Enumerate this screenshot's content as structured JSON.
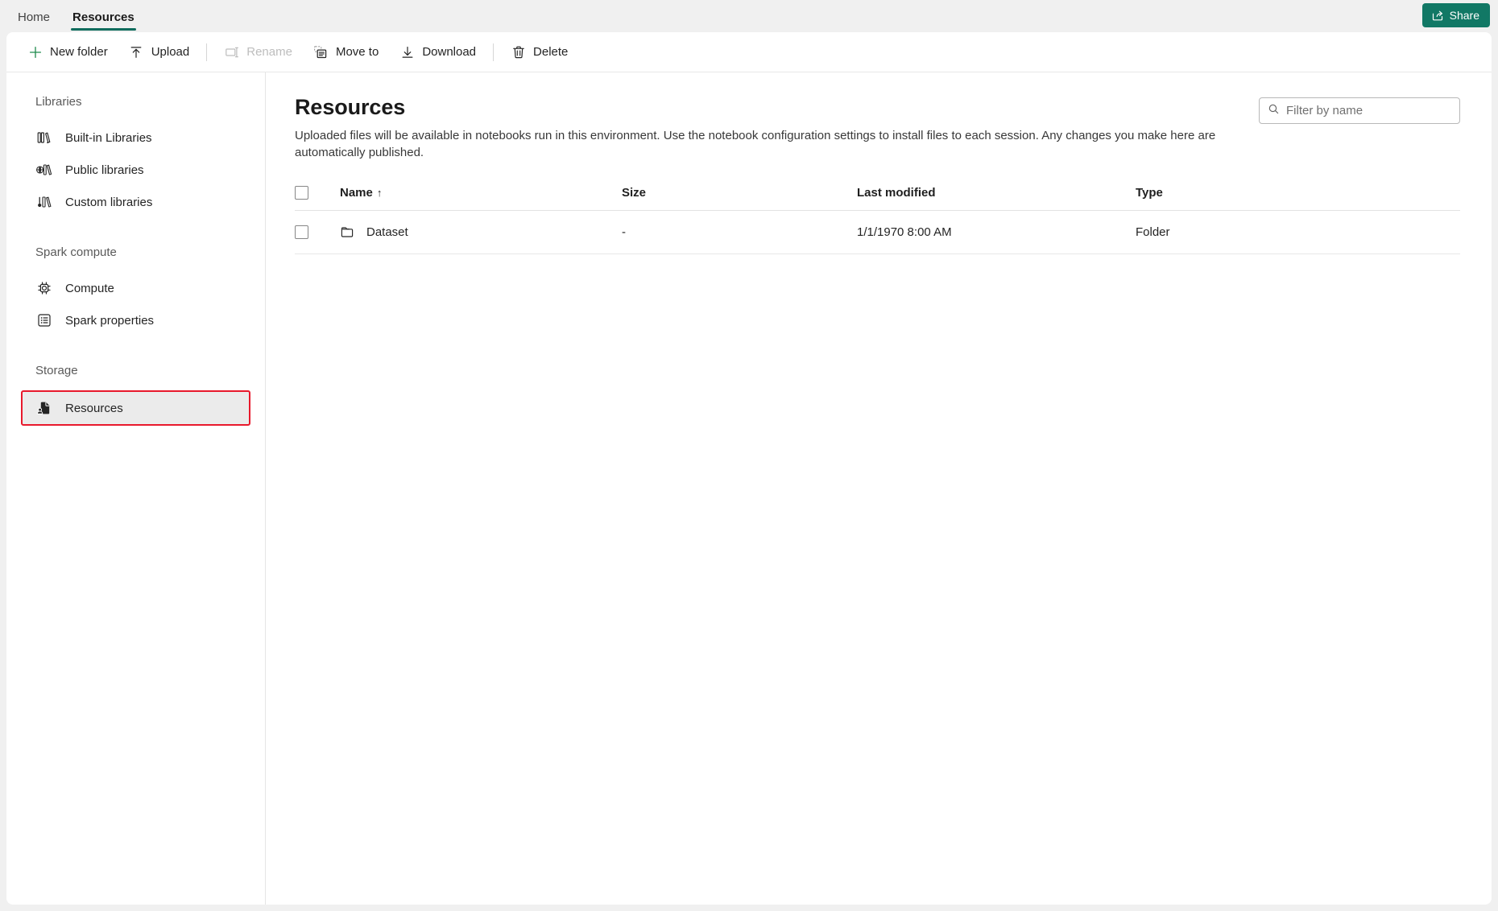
{
  "window": {
    "tabs": [
      {
        "label": "Home",
        "active": false
      },
      {
        "label": "Resources",
        "active": true
      }
    ],
    "share_label": "Share",
    "share_icon": "share-icon",
    "accent_color": "#117865",
    "tab_underline_color": "#0f6c5d",
    "highlight_color": "#e8192c"
  },
  "toolbar": {
    "items": [
      {
        "label": "New folder",
        "icon": "plus-icon",
        "disabled": false,
        "icon_color": "#1e8a4c"
      },
      {
        "label": "Upload",
        "icon": "upload-icon",
        "disabled": false,
        "icon_color": "#242424"
      },
      {
        "label": "Rename",
        "icon": "rename-icon",
        "disabled": true,
        "icon_color": "#bdbdbd"
      },
      {
        "label": "Move to",
        "icon": "move-to-icon",
        "disabled": false,
        "icon_color": "#242424"
      },
      {
        "label": "Download",
        "icon": "download-icon",
        "disabled": false,
        "icon_color": "#242424"
      },
      {
        "label": "Delete",
        "icon": "trash-icon",
        "disabled": false,
        "icon_color": "#242424"
      }
    ]
  },
  "sidebar": {
    "groups": [
      {
        "title": "Libraries",
        "items": [
          {
            "label": "Built-in Libraries",
            "icon": "books-icon",
            "selected": false
          },
          {
            "label": "Public libraries",
            "icon": "books-globe-icon",
            "selected": false
          },
          {
            "label": "Custom libraries",
            "icon": "books-custom-icon",
            "selected": false
          }
        ]
      },
      {
        "title": "Spark compute",
        "items": [
          {
            "label": "Compute",
            "icon": "cpu-chip-icon",
            "selected": false
          },
          {
            "label": "Spark properties",
            "icon": "list-box-icon",
            "selected": false
          }
        ]
      },
      {
        "title": "Storage",
        "items": [
          {
            "label": "Resources",
            "icon": "resource-file-icon",
            "selected": true
          }
        ]
      }
    ]
  },
  "main": {
    "title": "Resources",
    "description": "Uploaded files will be available in notebooks run in this environment. Use the notebook configuration settings to install files to each session. Any changes you make here are automatically published.",
    "filter": {
      "placeholder": "Filter by name",
      "value": "",
      "icon": "search-icon"
    },
    "table": {
      "select_all_checkbox": false,
      "columns": [
        {
          "key": "name",
          "label": "Name",
          "sorted": true,
          "sort_direction": "asc",
          "sort_glyph": "↑"
        },
        {
          "key": "size",
          "label": "Size",
          "sorted": false,
          "sort_direction": "",
          "sort_glyph": ""
        },
        {
          "key": "modified",
          "label": "Last modified",
          "sorted": false,
          "sort_direction": "",
          "sort_glyph": ""
        },
        {
          "key": "type",
          "label": "Type",
          "sorted": false,
          "sort_direction": "",
          "sort_glyph": ""
        }
      ],
      "rows": [
        {
          "checked": false,
          "icon": "folder-icon",
          "name": "Dataset",
          "size": "-",
          "modified": "1/1/1970 8:00 AM",
          "type": "Folder"
        }
      ]
    }
  }
}
